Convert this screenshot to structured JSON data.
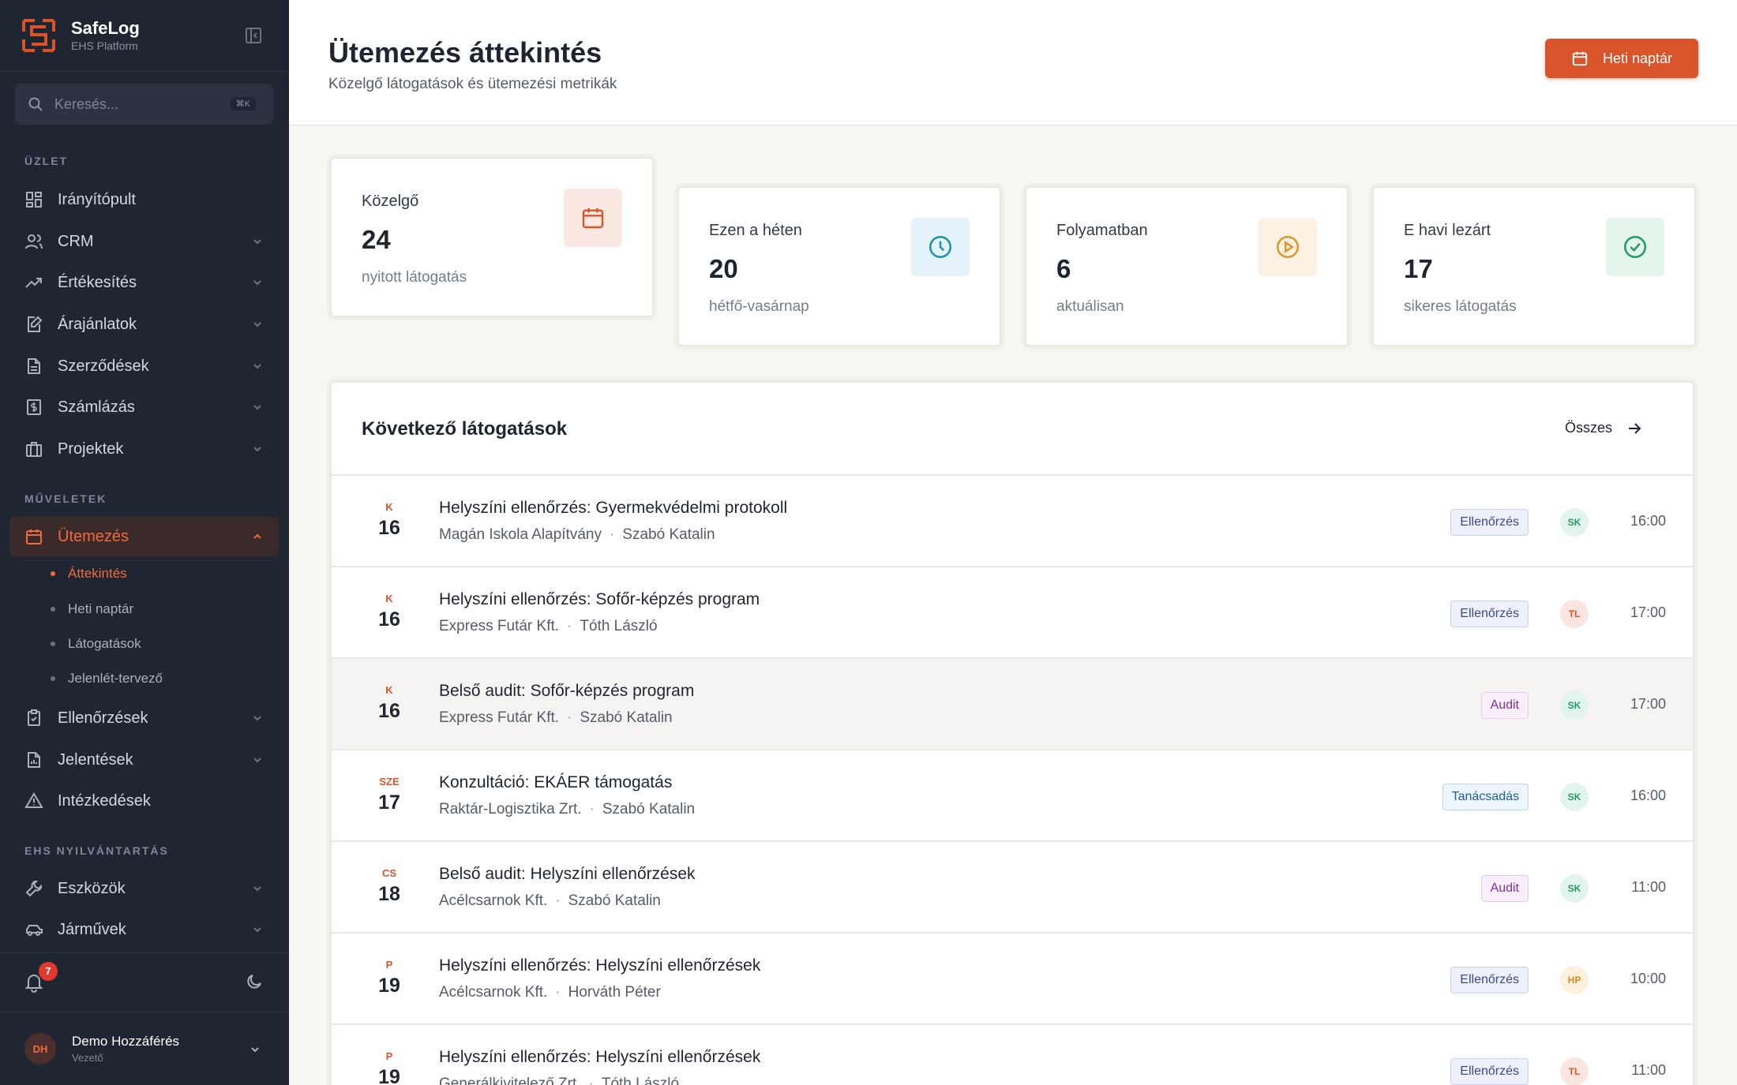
{
  "brand": {
    "name": "SafeLog",
    "subtitle": "EHS Platform"
  },
  "search": {
    "placeholder": "Keresés...",
    "shortcut": "⌘K"
  },
  "sections": {
    "business": "ÜZLET",
    "operations": "MŰVELETEK",
    "records": "EHS NYILVÁNTARTÁS"
  },
  "nav": {
    "dashboard": "Irányítópult",
    "crm": "CRM",
    "sales": "Értékesítés",
    "quotes": "Árajánlatok",
    "contracts": "Szerződések",
    "billing": "Számlázás",
    "projects": "Projektek",
    "scheduling": "Ütemezés",
    "sub_overview": "Áttekintés",
    "sub_weekly": "Heti naptár",
    "sub_visits": "Látogatások",
    "sub_attendance": "Jelenlét-tervező",
    "inspections": "Ellenőrzések",
    "reports": "Jelentések",
    "actions": "Intézkedések",
    "tools": "Eszközök",
    "vehicles": "Járművek"
  },
  "notifications": {
    "count": "7"
  },
  "user": {
    "initials": "DH",
    "name": "Demo Hozzáférés",
    "role": "Vezető"
  },
  "header": {
    "title": "Ütemezés áttekintés",
    "subtitle": "Közelgő látogatások és ütemezési metrikák",
    "calendar_button": "Heti naptár"
  },
  "stats": [
    {
      "label": "Közelgő",
      "value": "24",
      "desc": "nyitott látogatás",
      "icon": "calendar-icon",
      "color": "#d9542a"
    },
    {
      "label": "Ezen a héten",
      "value": "20",
      "desc": "hétfő-vasárnap",
      "icon": "clock-icon",
      "color": "#1f8fb0"
    },
    {
      "label": "Folyamatban",
      "value": "6",
      "desc": "aktuálisan",
      "icon": "play-circle-icon",
      "color": "#e0962b"
    },
    {
      "label": "E havi lezárt",
      "value": "17",
      "desc": "sikeres látogatás",
      "icon": "check-circle-icon",
      "color": "#1f9d63"
    }
  ],
  "visits": {
    "title": "Következő látogatások",
    "all_link": "Összes",
    "rows": [
      {
        "day": "K",
        "date": "16",
        "title": "Helyszíni ellenőrzés: Gyermekvédelmi protokoll",
        "client": "Magán Iskola Alapítvány",
        "person": "Szabó Katalin",
        "tag": "Ellenőrzés",
        "initials": "SK",
        "time": "16:00"
      },
      {
        "day": "K",
        "date": "16",
        "title": "Helyszíni ellenőrzés: Sofőr-képzés program",
        "client": "Express Futár Kft.",
        "person": "Tóth László",
        "tag": "Ellenőrzés",
        "initials": "TL",
        "time": "17:00"
      },
      {
        "day": "K",
        "date": "16",
        "title": "Belső audit: Sofőr-képzés program",
        "client": "Express Futár Kft.",
        "person": "Szabó Katalin",
        "tag": "Audit",
        "initials": "SK",
        "time": "17:00"
      },
      {
        "day": "SZE",
        "date": "17",
        "title": "Konzultáció: EKÁER támogatás",
        "client": "Raktár-Logisztika Zrt.",
        "person": "Szabó Katalin",
        "tag": "Tanácsadás",
        "initials": "SK",
        "time": "16:00"
      },
      {
        "day": "CS",
        "date": "18",
        "title": "Belső audit: Helyszíni ellenőrzések",
        "client": "Acélcsarnok Kft.",
        "person": "Szabó Katalin",
        "tag": "Audit",
        "initials": "SK",
        "time": "11:00"
      },
      {
        "day": "P",
        "date": "19",
        "title": "Helyszíni ellenőrzés: Helyszíni ellenőrzések",
        "client": "Acélcsarnok Kft.",
        "person": "Horváth Péter",
        "tag": "Ellenőrzés",
        "initials": "HP",
        "time": "10:00"
      },
      {
        "day": "P",
        "date": "19",
        "title": "Helyszíni ellenőrzés: Helyszíni ellenőrzések",
        "client": "Generálkivitelező Zrt.",
        "person": "Tóth László",
        "tag": "Ellenőrzés",
        "initials": "TL",
        "time": "11:00"
      }
    ]
  },
  "colors": {
    "accent": "#d9542a",
    "sidebar_bg": "#1f2632",
    "page_bg": "#f7f6f3"
  }
}
